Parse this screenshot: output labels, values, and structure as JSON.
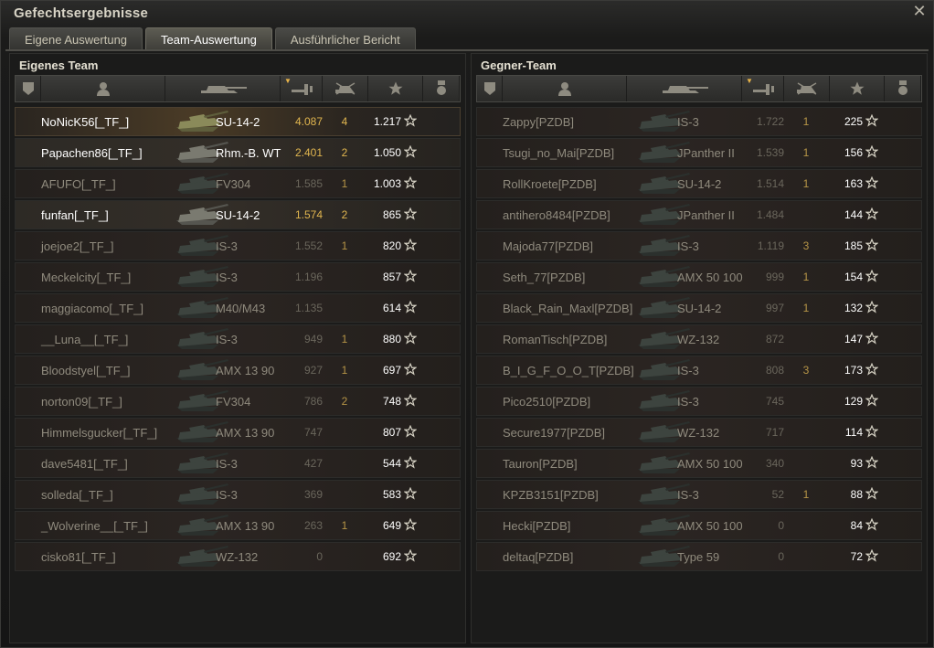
{
  "window": {
    "title": "Gefechtsergebnisse",
    "close_glyph": "✕"
  },
  "tabs": [
    {
      "label": "Eigene Auswertung",
      "active": false
    },
    {
      "label": "Team-Auswertung",
      "active": true
    },
    {
      "label": "Ausführlicher Bericht",
      "active": false
    }
  ],
  "headers": [
    "platoon-icon",
    "player-icon",
    "vehicle-icon",
    "damage-icon",
    "kills-icon",
    "xp-star-icon",
    "medal-icon"
  ],
  "colors": {
    "accent": "#e1b64f",
    "highlight_row": "#4a3b26",
    "row_bg": "#2b2522"
  },
  "own_team": {
    "title": "Eigenes Team",
    "rows": [
      {
        "name": "NoNicK56[_TF_]",
        "vehicle": "SU-14-2",
        "damage": "4.087",
        "kills": "4",
        "xp": "1.217",
        "state": "mine"
      },
      {
        "name": "Papachen86[_TF_]",
        "vehicle": "Rhm.-B. WT",
        "damage": "2.401",
        "kills": "2",
        "xp": "1.050",
        "state": "hl"
      },
      {
        "name": "AFUFO[_TF_]",
        "vehicle": "FV304",
        "damage": "1.585",
        "kills": "1",
        "xp": "1.003",
        "state": "dim"
      },
      {
        "name": "funfan[_TF_]",
        "vehicle": "SU-14-2",
        "damage": "1.574",
        "kills": "2",
        "xp": "865",
        "state": "hl"
      },
      {
        "name": "joejoe2[_TF_]",
        "vehicle": "IS-3",
        "damage": "1.552",
        "kills": "1",
        "xp": "820",
        "state": "dim"
      },
      {
        "name": "Meckelcity[_TF_]",
        "vehicle": "IS-3",
        "damage": "1.196",
        "kills": "",
        "xp": "857",
        "state": "dim"
      },
      {
        "name": "maggiacomo[_TF_]",
        "vehicle": "M40/M43",
        "damage": "1.135",
        "kills": "",
        "xp": "614",
        "state": "dim"
      },
      {
        "name": "__Luna__[_TF_]",
        "vehicle": "IS-3",
        "damage": "949",
        "kills": "1",
        "xp": "880",
        "state": "dim"
      },
      {
        "name": "Bloodstyel[_TF_]",
        "vehicle": "AMX 13 90",
        "damage": "927",
        "kills": "1",
        "xp": "697",
        "state": "dim"
      },
      {
        "name": "norton09[_TF_]",
        "vehicle": "FV304",
        "damage": "786",
        "kills": "2",
        "xp": "748",
        "state": "dim"
      },
      {
        "name": "Himmelsgucker[_TF_]",
        "vehicle": "AMX 13 90",
        "damage": "747",
        "kills": "",
        "xp": "807",
        "state": "dim"
      },
      {
        "name": "dave5481[_TF_]",
        "vehicle": "IS-3",
        "damage": "427",
        "kills": "",
        "xp": "544",
        "state": "dim"
      },
      {
        "name": "solleda[_TF_]",
        "vehicle": "IS-3",
        "damage": "369",
        "kills": "",
        "xp": "583",
        "state": "dim"
      },
      {
        "name": "_Wolverine__[_TF_]",
        "vehicle": "AMX 13 90",
        "damage": "263",
        "kills": "1",
        "xp": "649",
        "state": "dim"
      },
      {
        "name": "cisko81[_TF_]",
        "vehicle": "WZ-132",
        "damage": "0",
        "kills": "",
        "xp": "692",
        "state": "dim"
      }
    ]
  },
  "enemy_team": {
    "title": "Gegner-Team",
    "rows": [
      {
        "name": "Zappy[PZDB]",
        "vehicle": "IS-3",
        "damage": "1.722",
        "kills": "1",
        "xp": "225",
        "state": "dim"
      },
      {
        "name": "Tsugi_no_Mai[PZDB]",
        "vehicle": "JPanther II",
        "damage": "1.539",
        "kills": "1",
        "xp": "156",
        "state": "dim"
      },
      {
        "name": "RollKroete[PZDB]",
        "vehicle": "SU-14-2",
        "damage": "1.514",
        "kills": "1",
        "xp": "163",
        "state": "dim"
      },
      {
        "name": "antihero8484[PZDB]",
        "vehicle": "JPanther II",
        "damage": "1.484",
        "kills": "",
        "xp": "144",
        "state": "dim"
      },
      {
        "name": "Majoda77[PZDB]",
        "vehicle": "IS-3",
        "damage": "1.119",
        "kills": "3",
        "xp": "185",
        "state": "dim"
      },
      {
        "name": "Seth_77[PZDB]",
        "vehicle": "AMX 50 100",
        "damage": "999",
        "kills": "1",
        "xp": "154",
        "state": "dim"
      },
      {
        "name": "Black_Rain_Maxl[PZDB]",
        "vehicle": "SU-14-2",
        "damage": "997",
        "kills": "1",
        "xp": "132",
        "state": "dim"
      },
      {
        "name": "RomanTisch[PZDB]",
        "vehicle": "WZ-132",
        "damage": "872",
        "kills": "",
        "xp": "147",
        "state": "dim"
      },
      {
        "name": "B_I_G_F_O_O_T[PZDB]",
        "vehicle": "IS-3",
        "damage": "808",
        "kills": "3",
        "xp": "173",
        "state": "dim"
      },
      {
        "name": "Pico2510[PZDB]",
        "vehicle": "IS-3",
        "damage": "745",
        "kills": "",
        "xp": "129",
        "state": "dim"
      },
      {
        "name": "Secure1977[PZDB]",
        "vehicle": "WZ-132",
        "damage": "717",
        "kills": "",
        "xp": "114",
        "state": "dim"
      },
      {
        "name": "Tauron[PZDB]",
        "vehicle": "AMX 50 100",
        "damage": "340",
        "kills": "",
        "xp": "93",
        "state": "dim"
      },
      {
        "name": "KPZB3151[PZDB]",
        "vehicle": "IS-3",
        "damage": "52",
        "kills": "1",
        "xp": "88",
        "state": "dim"
      },
      {
        "name": "Hecki[PZDB]",
        "vehicle": "AMX 50 100",
        "damage": "0",
        "kills": "",
        "xp": "84",
        "state": "dim"
      },
      {
        "name": "deltaq[PZDB]",
        "vehicle": "Type 59",
        "damage": "0",
        "kills": "",
        "xp": "72",
        "state": "dim"
      }
    ]
  }
}
